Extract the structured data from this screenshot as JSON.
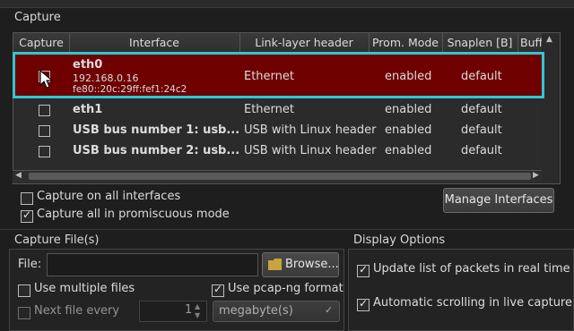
{
  "capture_section": {
    "label": "Capture"
  },
  "table": {
    "headers": [
      "Capture",
      "Interface",
      "Link-layer header",
      "Prom. Mode",
      "Snaplen [B]",
      "Buff"
    ],
    "rows": [
      {
        "name": "eth0",
        "ip": "192.168.0.16",
        "ipv6": "fe80::20c:29ff:fef1:24c2",
        "link": "Ethernet",
        "prom": "enabled",
        "snaplen": "default",
        "selected": true
      },
      {
        "name": "eth1",
        "link": "Ethernet",
        "prom": "enabled",
        "snaplen": "default"
      },
      {
        "name": "USB bus number 1: usb...",
        "link": "USB with Linux header",
        "prom": "enabled",
        "snaplen": "default"
      },
      {
        "name": "USB bus number 2: usb...",
        "link": "USB with Linux header",
        "prom": "enabled",
        "snaplen": "default"
      }
    ]
  },
  "options": {
    "capture_all": "Capture on all interfaces",
    "capture_all_checked": false,
    "promiscuous": "Capture all in promiscuous mode",
    "promiscuous_checked": true,
    "manage_button": "Manage Interfaces"
  },
  "capture_files": {
    "label": "Capture File(s)",
    "file_label": "File:",
    "file_value": "",
    "browse_button": "Browse...",
    "multiple_files": "Use multiple files",
    "multiple_files_checked": false,
    "pcapng": "Use pcap-ng format",
    "pcapng_checked": true,
    "next_file": "Next file every",
    "next_file_value": "1",
    "unit": "megabyte(s)"
  },
  "display_options": {
    "label": "Display Options",
    "update_list": "Update list of packets in real time",
    "update_list_checked": true,
    "auto_scroll": "Automatic scrolling in live capture",
    "auto_scroll_checked": true
  },
  "colors": {
    "selection": "#6e0000",
    "highlight": "#2ec7d3"
  }
}
